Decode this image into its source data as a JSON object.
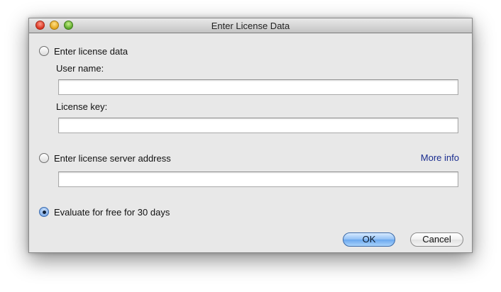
{
  "window": {
    "title": "Enter License Data"
  },
  "options": {
    "license_data": {
      "label": "Enter license data",
      "selected": false
    },
    "license_server": {
      "label": "Enter license server address",
      "selected": false
    },
    "evaluate": {
      "label": "Evaluate for free for 30 days",
      "selected": true
    }
  },
  "fields": {
    "user_name": {
      "label": "User name:",
      "value": ""
    },
    "license_key": {
      "label": "License key:",
      "value": ""
    },
    "server_address": {
      "value": ""
    }
  },
  "links": {
    "more_info": "More info"
  },
  "buttons": {
    "ok": "OK",
    "cancel": "Cancel"
  },
  "colors": {
    "window_bg": "#e8e8e8",
    "link": "#1a2d8f",
    "default_button": "#6aa7ee"
  }
}
